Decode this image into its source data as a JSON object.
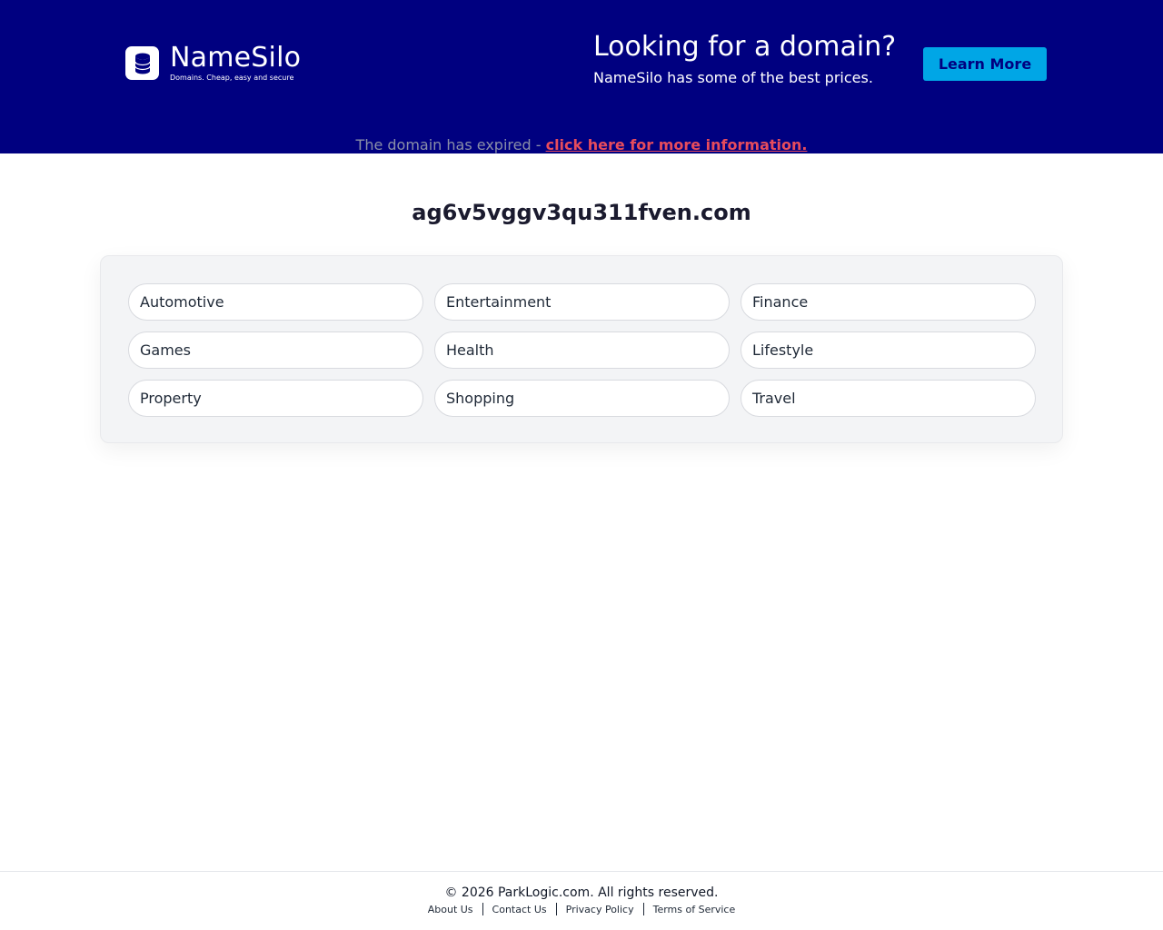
{
  "header": {
    "logo_name": "NameSilo",
    "logo_tagline": "Domains. Cheap, easy and secure",
    "logo_icon": "database-icon",
    "promo_title": "Looking for a domain?",
    "promo_subtitle": "NameSilo has some of the best prices.",
    "learn_more_label": "Learn More"
  },
  "notice": {
    "text": "The domain has expired - ",
    "link_text": "click here for more information."
  },
  "domain": "ag6v5vggv3qu311fven.com",
  "categories": [
    "Automotive",
    "Entertainment",
    "Finance",
    "Games",
    "Health",
    "Lifestyle",
    "Property",
    "Shopping",
    "Travel"
  ],
  "footer": {
    "copyright": "© 2026 ParkLogic.com. All rights reserved.",
    "links": [
      "About Us",
      "Contact Us",
      "Privacy Policy",
      "Terms of Service"
    ]
  },
  "colors": {
    "header_bg": "#000080",
    "button_bg": "#00a6e6",
    "link_red": "#e74c5c"
  }
}
